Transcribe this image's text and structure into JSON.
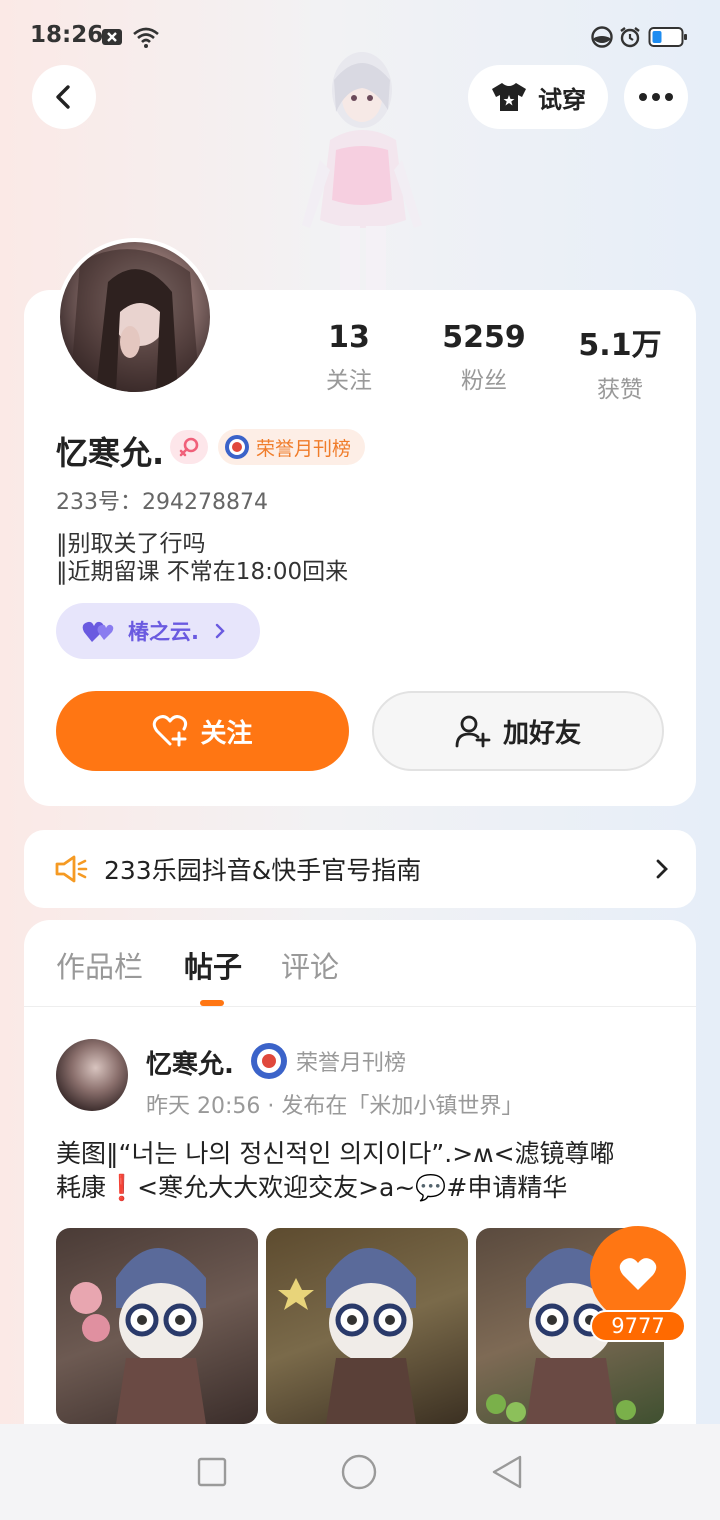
{
  "status_bar": {
    "time": "18:26",
    "icons": [
      "notification-x-icon",
      "wifi-icon",
      "vpn-icon",
      "alarm-icon",
      "battery-icon"
    ]
  },
  "header": {
    "back_icon": "chevron-left-icon",
    "try_on_label": "试穿",
    "try_on_icon": "tshirt-icon",
    "more_icon": "more-dots-icon"
  },
  "profile": {
    "stats": [
      {
        "value": "13",
        "label": "关注"
      },
      {
        "value": "5259",
        "label": "粉丝"
      },
      {
        "value": "5.1万",
        "label": "获赞"
      }
    ],
    "nickname": "忆寒允.",
    "gender_icon": "female-icon",
    "honor_badge": "荣誉月刊榜",
    "uid": "233号：294278874",
    "bio_lines": [
      "‖别取关了行吗",
      "‖近期留课 不常在18:00回来"
    ],
    "cp_tag": "椿之云.",
    "follow_label": "关注",
    "add_friend_label": "加好友"
  },
  "notice": {
    "text": "233乐园抖音&快手官号指南"
  },
  "tabs": [
    {
      "label": "作品栏",
      "active": false
    },
    {
      "label": "帖子",
      "active": true
    },
    {
      "label": "评论",
      "active": false
    }
  ],
  "post": {
    "author": "忆寒允.",
    "honor": "荣誉月刊榜",
    "meta": "昨天 20:56 · 发布在「米加小镇世界」",
    "text_line1": "美图‖“너는 나의 정신적인 의지이다”.>ʍ<滤镜尊嘟",
    "text_line2": "耗康❗<寒允大大欢迎交友>a~💬#申请精华",
    "like_count": "9777"
  },
  "colors": {
    "accent": "#ff7613",
    "cp_purple": "#6a5ae0",
    "muted": "#999999"
  }
}
